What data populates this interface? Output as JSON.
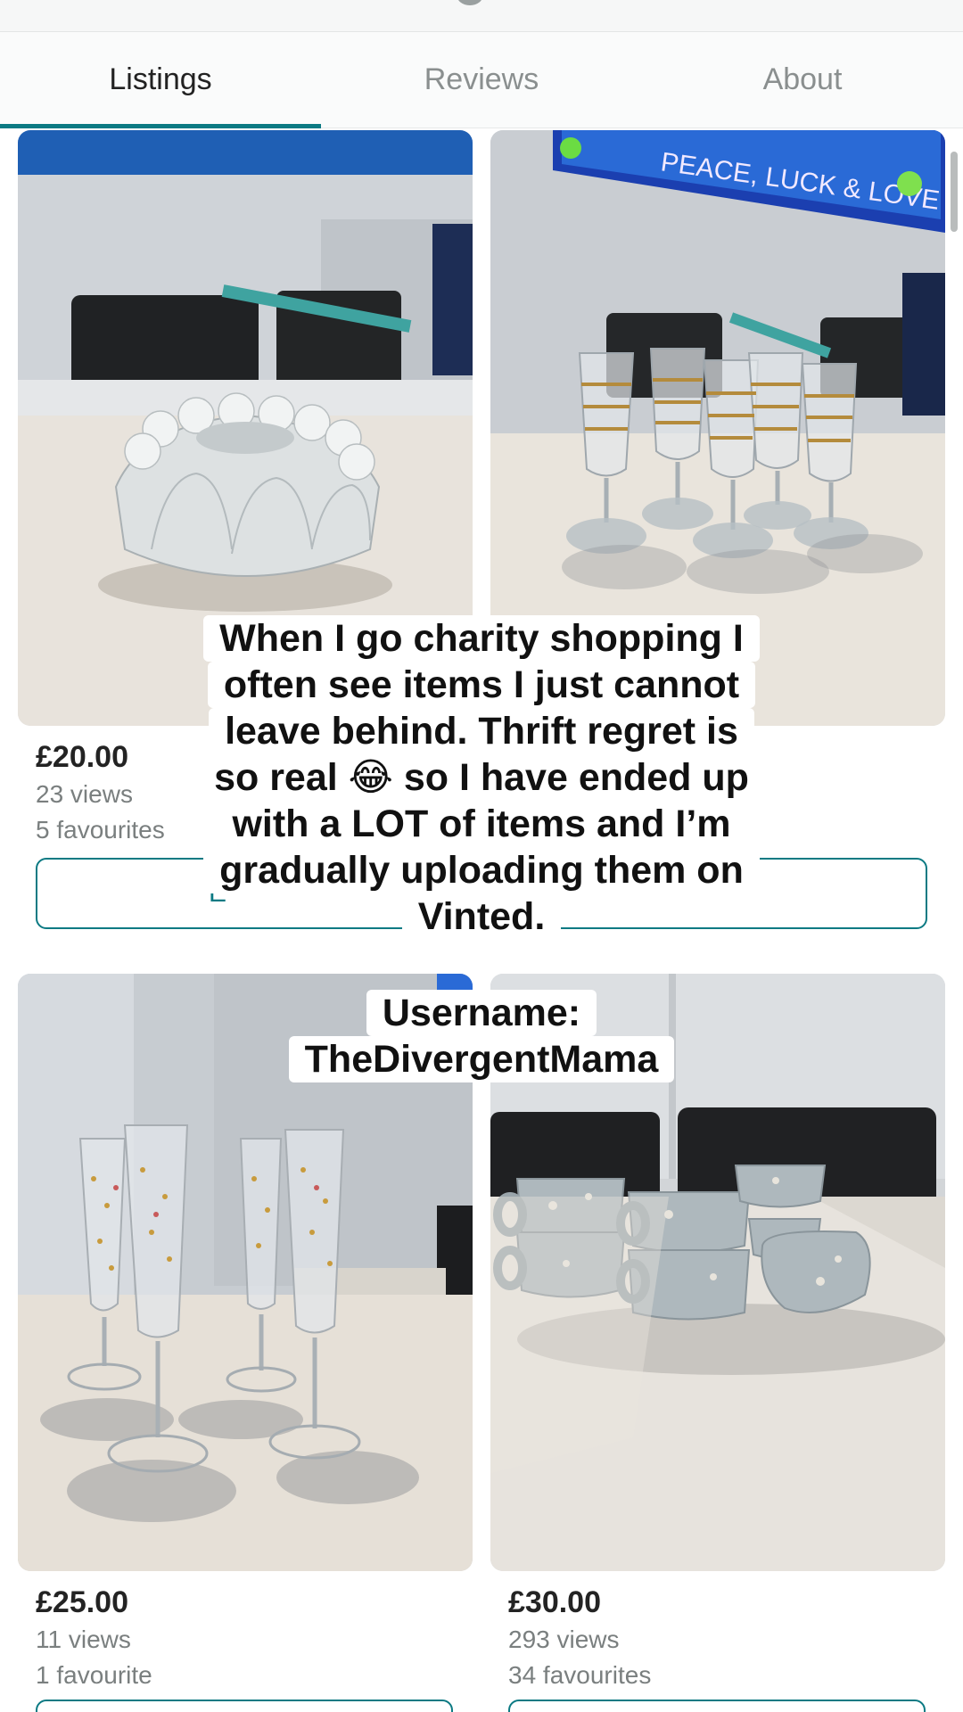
{
  "tabs": [
    {
      "label": "Listings",
      "active": true
    },
    {
      "label": "Reviews",
      "active": false
    },
    {
      "label": "About",
      "active": false
    }
  ],
  "accent_color": "#0b7a83",
  "listings": [
    {
      "price": "£20.00",
      "views": "23 views",
      "favourites": "5 favourites",
      "button_label": "E",
      "photo": "white ceramic jelly mould on table"
    },
    {
      "price": "",
      "views": "",
      "favourites": "",
      "button_label": "",
      "photo": "gold banded wine glasses, peace luck & love sign"
    },
    {
      "price": "£25.00",
      "views": "11 views",
      "favourites": "1 favourite",
      "button_label": "",
      "photo": "gold dotted champagne flutes"
    },
    {
      "price": "£30.00",
      "views": "293 views",
      "favourites": "34 favourites",
      "button_label": "",
      "photo": "speckled grey cups and jug"
    }
  ],
  "sign_text": "PEACE, LUCK & LOVE",
  "overlay": {
    "caption_lines": [
      "When I go charity shopping I",
      "often see items I just cannot",
      "leave behind. Thrift regret is",
      "so real 😂 so I have ended up",
      "with a LOT of items and I’m",
      "gradually uploading them on",
      "Vinted."
    ],
    "username_lines": [
      "Username:",
      "TheDivergentMama"
    ]
  }
}
